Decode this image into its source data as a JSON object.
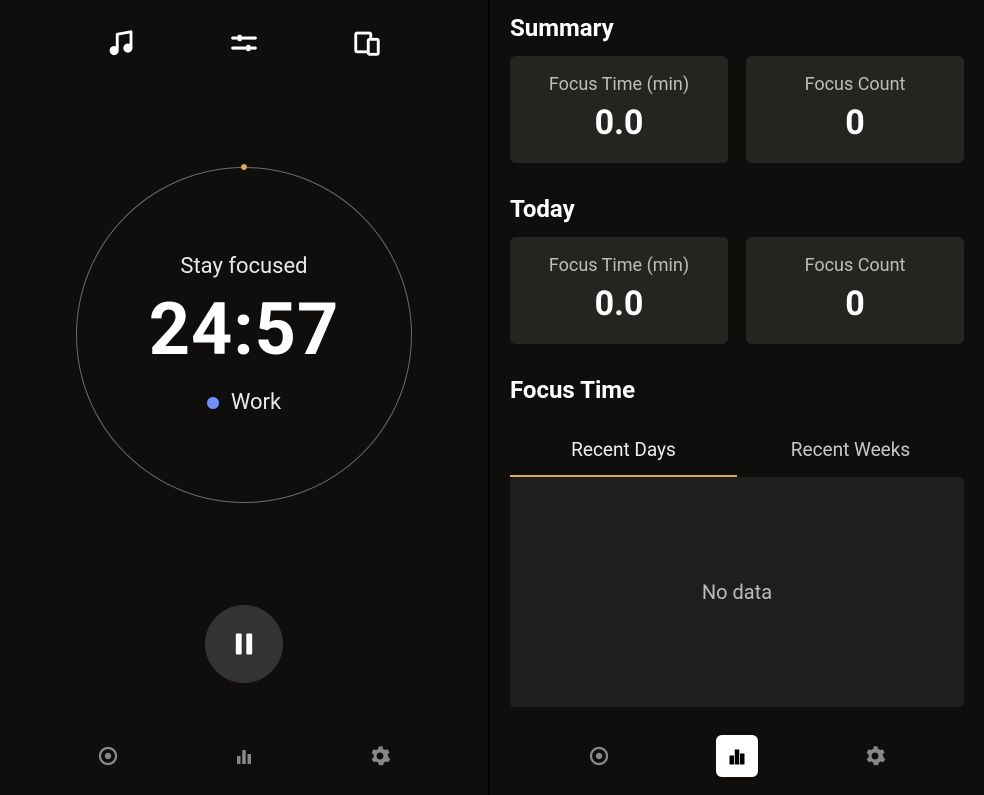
{
  "timer": {
    "stay_focused": "Stay focused",
    "time": "24:57",
    "tag_label": "Work",
    "tag_color": "#6f8fff"
  },
  "top_icons": {
    "music": "music-icon",
    "sliders": "sliders-icon",
    "devices": "devices-icon"
  },
  "controls": {
    "pause": "pause"
  },
  "nav": {
    "timer": "timer",
    "stats": "stats",
    "settings": "settings"
  },
  "stats": {
    "summary": {
      "title": "Summary",
      "focus_time_label": "Focus Time (min)",
      "focus_time_value": "0.0",
      "focus_count_label": "Focus Count",
      "focus_count_value": "0"
    },
    "today": {
      "title": "Today",
      "focus_time_label": "Focus Time (min)",
      "focus_time_value": "0.0",
      "focus_count_label": "Focus Count",
      "focus_count_value": "0"
    },
    "focus_time_section": {
      "title": "Focus Time",
      "tabs": {
        "recent_days": "Recent Days",
        "recent_weeks": "Recent Weeks"
      },
      "no_data": "No data"
    }
  }
}
